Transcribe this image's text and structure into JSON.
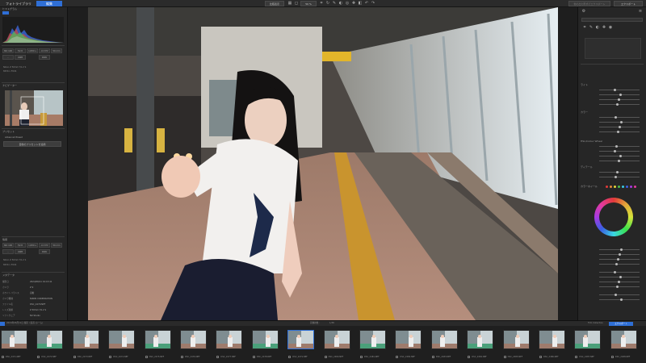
{
  "topbar": {
    "library_tab": "フォトライブラリ",
    "edit_tab": "編集",
    "compare_button": "比較表示",
    "zoom_value": "50 %",
    "export_button": "エクスポート",
    "left_placeholder_button": "他の出力形式でエクスポート"
  },
  "left_panel": {
    "histogram_title": "ヒストグラム",
    "cam_buttons": [
      "ISO 100",
      "f/2.8",
      "1/250 s",
      "-0.3 EV",
      "50 mm"
    ],
    "cam_row2": [
      "-",
      "AWB",
      "RAW"
    ],
    "lens_line": "Nikon Z 50mm f/1.2 S",
    "size_line": "8256 x 5504",
    "navigator_title": "ナビゲーター",
    "presets_title": "プリセット",
    "auto_section": "Advanced Preset",
    "auto_button": "自動のプリセットを適用",
    "camera_settings_title": "情報",
    "meta_title": "メタデータ",
    "meta": [
      {
        "k": "撮影日",
        "v": "2024/08/11 19:15:41"
      },
      {
        "k": "カメラ",
        "v": "Z 9"
      },
      {
        "k": "ホワイトバランス",
        "v": "自動"
      },
      {
        "k": "カメラ機種",
        "v": "NIKON CORPORATION"
      },
      {
        "k": "ファイル名",
        "v": "DSC_2479.NEF"
      },
      {
        "k": "レンズ種類",
        "v": "Z 50mm f/1.2 S"
      },
      {
        "k": "ソフトウェア",
        "v": "NX Studio"
      }
    ]
  },
  "right_panel": {
    "section_titles": [
      "ライト",
      "カラー",
      "HSL/Colour Wheel",
      "ディテール"
    ],
    "colour_wheel_label": "カラーホイール"
  },
  "filmstrip": {
    "bar_left": "2024年08月11日 撮影 / 鉄道 (ホーム)",
    "bar_center_label": "画像枚数 :",
    "bar_center_value": "1/38",
    "collection_label": "Film Collection",
    "export_label": "エクスポート",
    "thumbs": [
      "DSC_2471.NEF",
      "DSC_2472.NEF",
      "DSC_2473.NEF",
      "DSC_2474.NEF",
      "DSC_2475.NEF",
      "DSC_2476.NEF",
      "DSC_2477.NEF",
      "DSC_2478.NEF",
      "DSC_2479.NEF",
      "DSC_2480.NEF",
      "DSC_2481.NEF",
      "DSC_2482.NEF",
      "DSC_2483.NEF",
      "DSC_2484.NEF",
      "DSC_2485.NEF",
      "DSC_2486.NEF",
      "DSC_2487.NEF",
      "DSC_2488.NEF"
    ]
  },
  "colors": {
    "accent": "#2f6fd6",
    "panel": "#262626",
    "background": "#1e1e1e"
  }
}
